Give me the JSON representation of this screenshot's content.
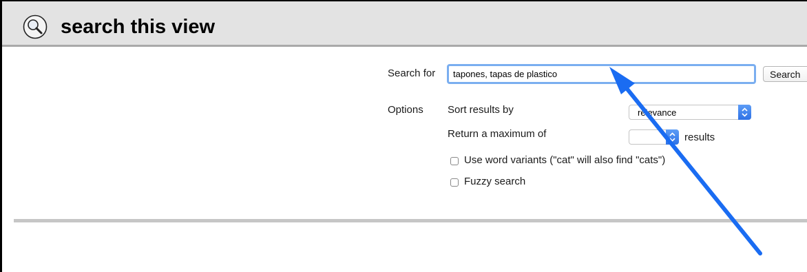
{
  "header": {
    "icon": "magnifier-icon",
    "title": "search this view"
  },
  "search": {
    "label": "Search for",
    "value": "tapones, tapas de plastico",
    "button_label": "Search"
  },
  "options": {
    "label": "Options",
    "sort_label": "Sort results by",
    "sort_value": "relevance",
    "max_label": "Return a maximum of",
    "max_value": "",
    "max_suffix": "results",
    "word_variants_label": "Use word variants (\"cat\" will also find \"cats\")",
    "word_variants_checked": false,
    "fuzzy_label": "Fuzzy search",
    "fuzzy_checked": false
  },
  "annotation": {
    "arrow_color": "#1a6cf2"
  },
  "colors": {
    "header_bg": "#e3e3e3",
    "focus_ring": "#7aaef0",
    "select_accent": "#2f72e6"
  }
}
